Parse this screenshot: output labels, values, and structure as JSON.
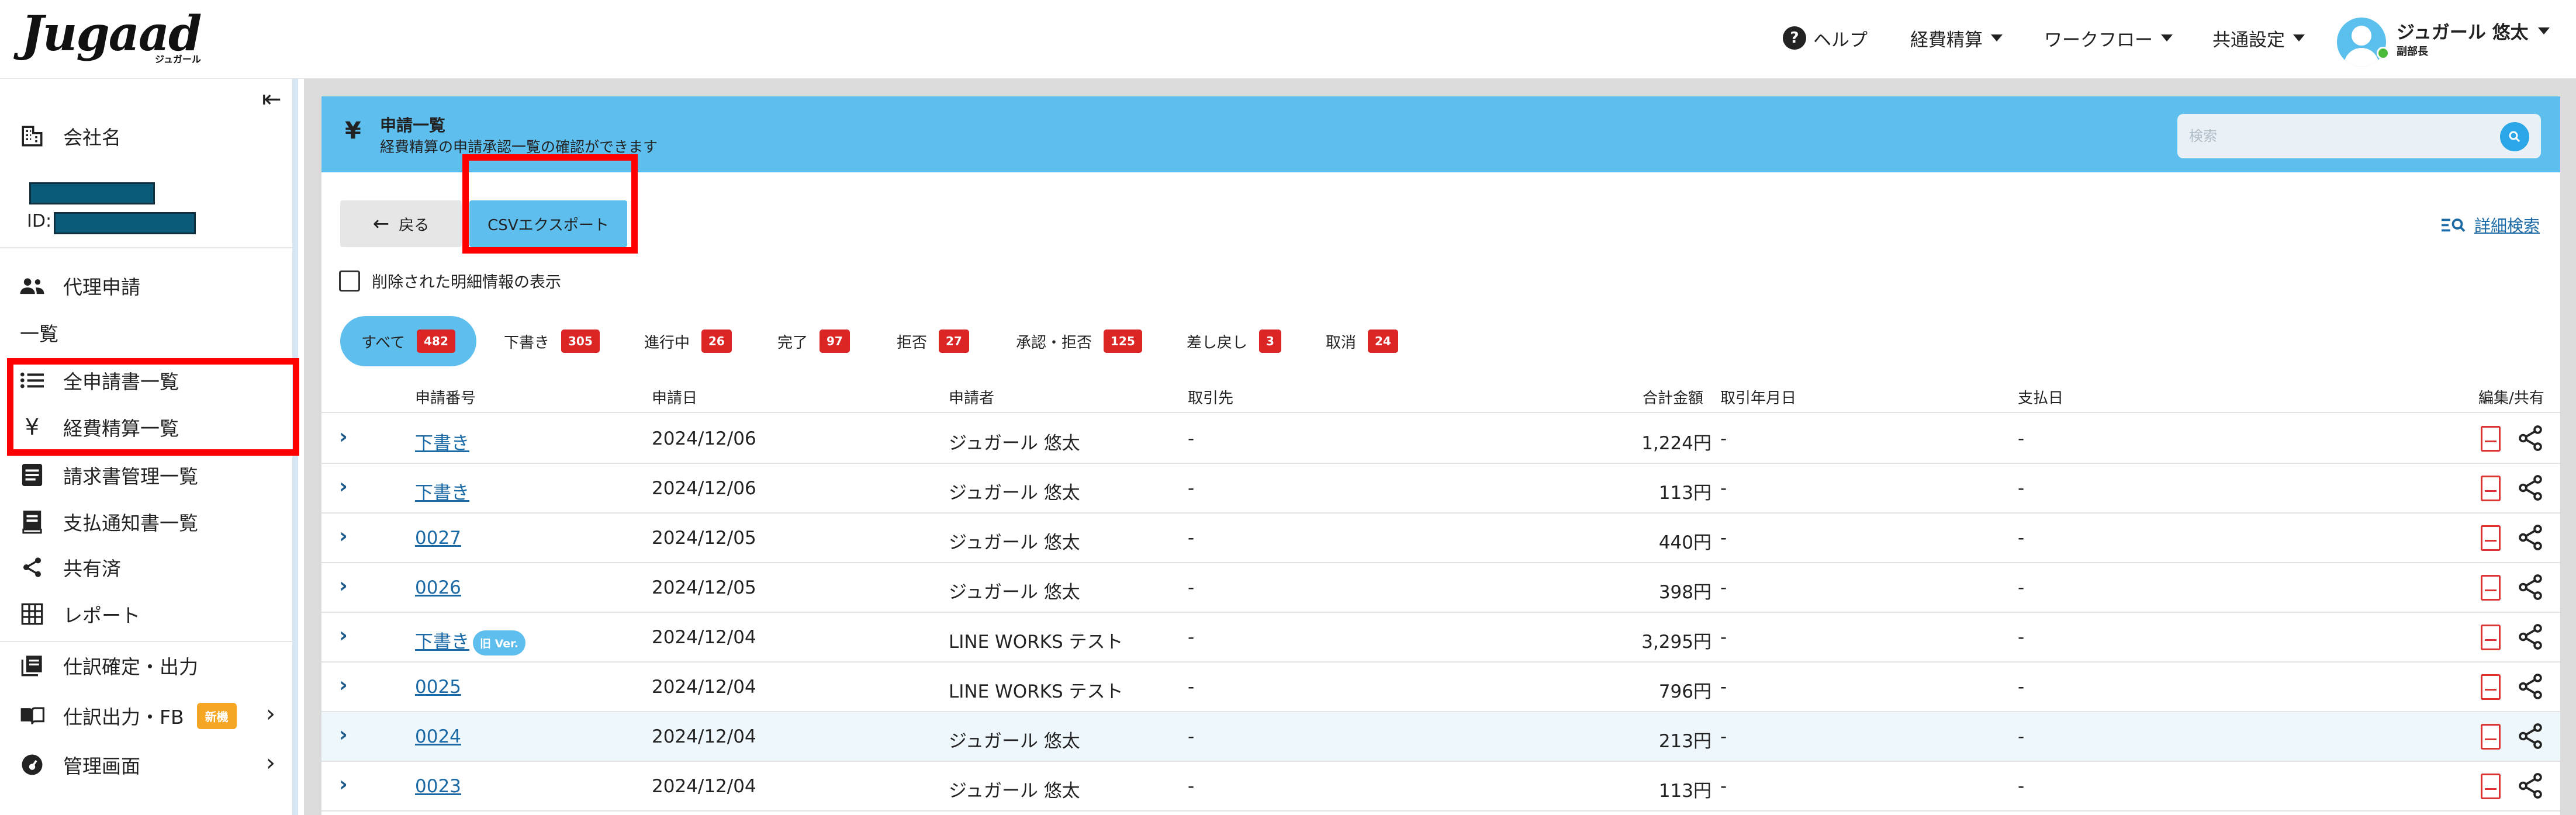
{
  "brand": {
    "logo": "Jugaad",
    "logo_sub": "ジュガール"
  },
  "topnav": {
    "help": "ヘルプ",
    "expense": "経費精算",
    "workflow": "ワークフロー",
    "common": "共通設定",
    "user_name": "ジュガール 悠太",
    "user_role": "副部長"
  },
  "sidebar": {
    "company": "会社名",
    "id_label": "ID:",
    "proxy": "代理申請",
    "section": "一覧",
    "all_apps": "全申請書一覧",
    "expense_list": "経費精算一覧",
    "invoice": "請求書管理一覧",
    "payment_notice": "支払通知書一覧",
    "shared": "共有済",
    "report": "レポート",
    "journal_confirm": "仕訳確定・出力",
    "journal_fb": "仕訳出力・FB",
    "new_badge": "新機",
    "admin": "管理画面"
  },
  "header": {
    "title": "申請一覧",
    "subtitle": "経費精算の申請承認一覧の確認ができます",
    "search_placeholder": "検索"
  },
  "actions": {
    "back": "戻る",
    "csv": "CSVエクスポート",
    "advanced": "詳細検索",
    "deleted_toggle": "削除された明細情報の表示"
  },
  "tabs": [
    {
      "label": "すべて",
      "count": "482"
    },
    {
      "label": "下書き",
      "count": "305"
    },
    {
      "label": "進行中",
      "count": "26"
    },
    {
      "label": "完了",
      "count": "97"
    },
    {
      "label": "拒否",
      "count": "27"
    },
    {
      "label": "承認・拒否",
      "count": "125"
    },
    {
      "label": "差し戻し",
      "count": "3"
    },
    {
      "label": "取消",
      "count": "24"
    }
  ],
  "columns": {
    "number": "申請番号",
    "date": "申請日",
    "applicant": "申請者",
    "client": "取引先",
    "total": "合計金額",
    "txn_month": "取引年月日",
    "pay_date": "支払日",
    "edit_share": "編集/共有"
  },
  "rows": [
    {
      "number": "下書き",
      "date": "2024/12/06",
      "applicant": "ジュガール 悠太",
      "client": "-",
      "total": "1,224円",
      "txn": "-",
      "pay": "-",
      "old": ""
    },
    {
      "number": "下書き",
      "date": "2024/12/06",
      "applicant": "ジュガール 悠太",
      "client": "-",
      "total": "113円",
      "txn": "-",
      "pay": "-",
      "old": ""
    },
    {
      "number": "0027",
      "date": "2024/12/05",
      "applicant": "ジュガール 悠太",
      "client": "-",
      "total": "440円",
      "txn": "-",
      "pay": "-",
      "old": ""
    },
    {
      "number": "0026",
      "date": "2024/12/05",
      "applicant": "ジュガール 悠太",
      "client": "-",
      "total": "398円",
      "txn": "-",
      "pay": "-",
      "old": ""
    },
    {
      "number": "下書き",
      "date": "2024/12/04",
      "applicant": "LINE WORKS テスト",
      "client": "-",
      "total": "3,295円",
      "txn": "-",
      "pay": "-",
      "old": "旧 Ver."
    },
    {
      "number": "0025",
      "date": "2024/12/04",
      "applicant": "LINE WORKS テスト",
      "client": "-",
      "total": "796円",
      "txn": "-",
      "pay": "-",
      "old": ""
    },
    {
      "number": "0024",
      "date": "2024/12/04",
      "applicant": "ジュガール 悠太",
      "client": "-",
      "total": "213円",
      "txn": "-",
      "pay": "-",
      "old": ""
    },
    {
      "number": "0023",
      "date": "2024/12/04",
      "applicant": "ジュガール 悠太",
      "client": "-",
      "total": "113円",
      "txn": "-",
      "pay": "-",
      "old": ""
    }
  ],
  "colors": {
    "accent": "#5ebfee",
    "badge_red": "#dc2626",
    "highlight_red": "#ff0000",
    "link": "#1b6aa5"
  }
}
